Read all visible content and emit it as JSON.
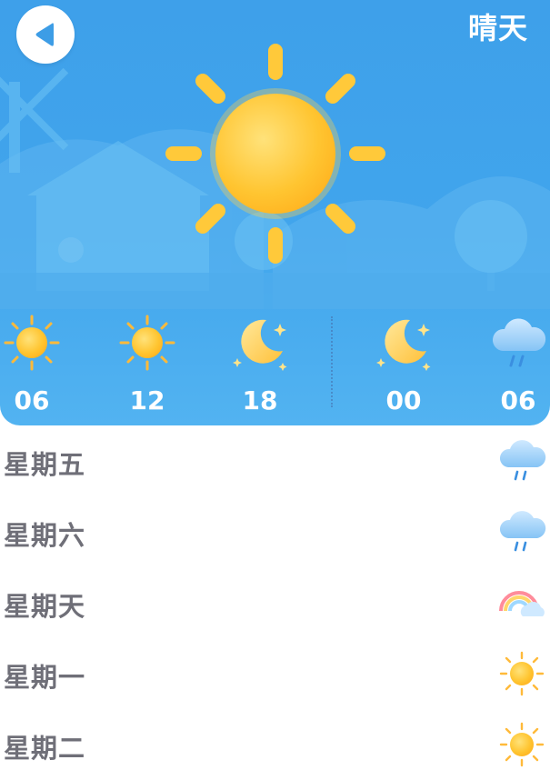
{
  "header": {
    "title": "晴天",
    "back_icon": "back-arrow-icon"
  },
  "current": {
    "icon": "sun-icon"
  },
  "hourly": [
    {
      "time": "06",
      "icon": "sun-icon"
    },
    {
      "time": "12",
      "icon": "sun-icon"
    },
    {
      "time": "18",
      "icon": "moon-stars-icon"
    },
    {
      "time": "00",
      "icon": "moon-stars-icon"
    },
    {
      "time": "06",
      "icon": "cloud-rain-icon"
    }
  ],
  "daily": [
    {
      "day": "星期五",
      "icon": "cloud-rain-icon"
    },
    {
      "day": "星期六",
      "icon": "cloud-rain-icon"
    },
    {
      "day": "星期天",
      "icon": "rainbow-cloud-icon"
    },
    {
      "day": "星期一",
      "icon": "sun-icon"
    },
    {
      "day": "星期二",
      "icon": "sun-icon"
    }
  ],
  "colors": {
    "sky": "#41a5ec",
    "sun": "#ffc93a",
    "day_text": "#6f6f78",
    "header_text": "#ffffff"
  }
}
